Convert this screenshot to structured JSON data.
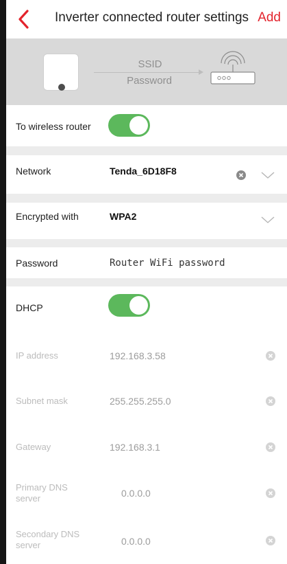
{
  "header": {
    "back_icon": "chevron-left-icon",
    "title": "Inverter connected router settings",
    "add_label": "Add"
  },
  "banner": {
    "ssid_label": "SSID",
    "password_label": "Password"
  },
  "form": {
    "wireless": {
      "label": "To wireless router",
      "enabled": true
    },
    "network": {
      "label": "Network",
      "value": "Tenda_6D18F8"
    },
    "encryption": {
      "label": "Encrypted with",
      "value": "WPA2"
    },
    "password": {
      "label": "Password",
      "placeholder": "Router WiFi password"
    },
    "dhcp": {
      "label": "DHCP",
      "enabled": true
    },
    "ip": {
      "label": "IP address",
      "value": "192.168.3.58"
    },
    "subnet": {
      "label": "Subnet mask",
      "value": "255.255.255.0"
    },
    "gateway": {
      "label": "Gateway",
      "value": "192.168.3.1"
    },
    "dns1": {
      "label_line1": "Primary DNS",
      "label_line2": "server",
      "value": "0.0.0.0"
    },
    "dns2": {
      "label_line1": "Secondary DNS",
      "label_line2": "server",
      "value": "0.0.0.0"
    }
  },
  "colors": {
    "accent": "#e3232c",
    "toggle_on": "#5cb85c",
    "banner_bg": "#d9d9d9",
    "separator": "#ececec",
    "disabled_text": "#bcbcbc"
  }
}
